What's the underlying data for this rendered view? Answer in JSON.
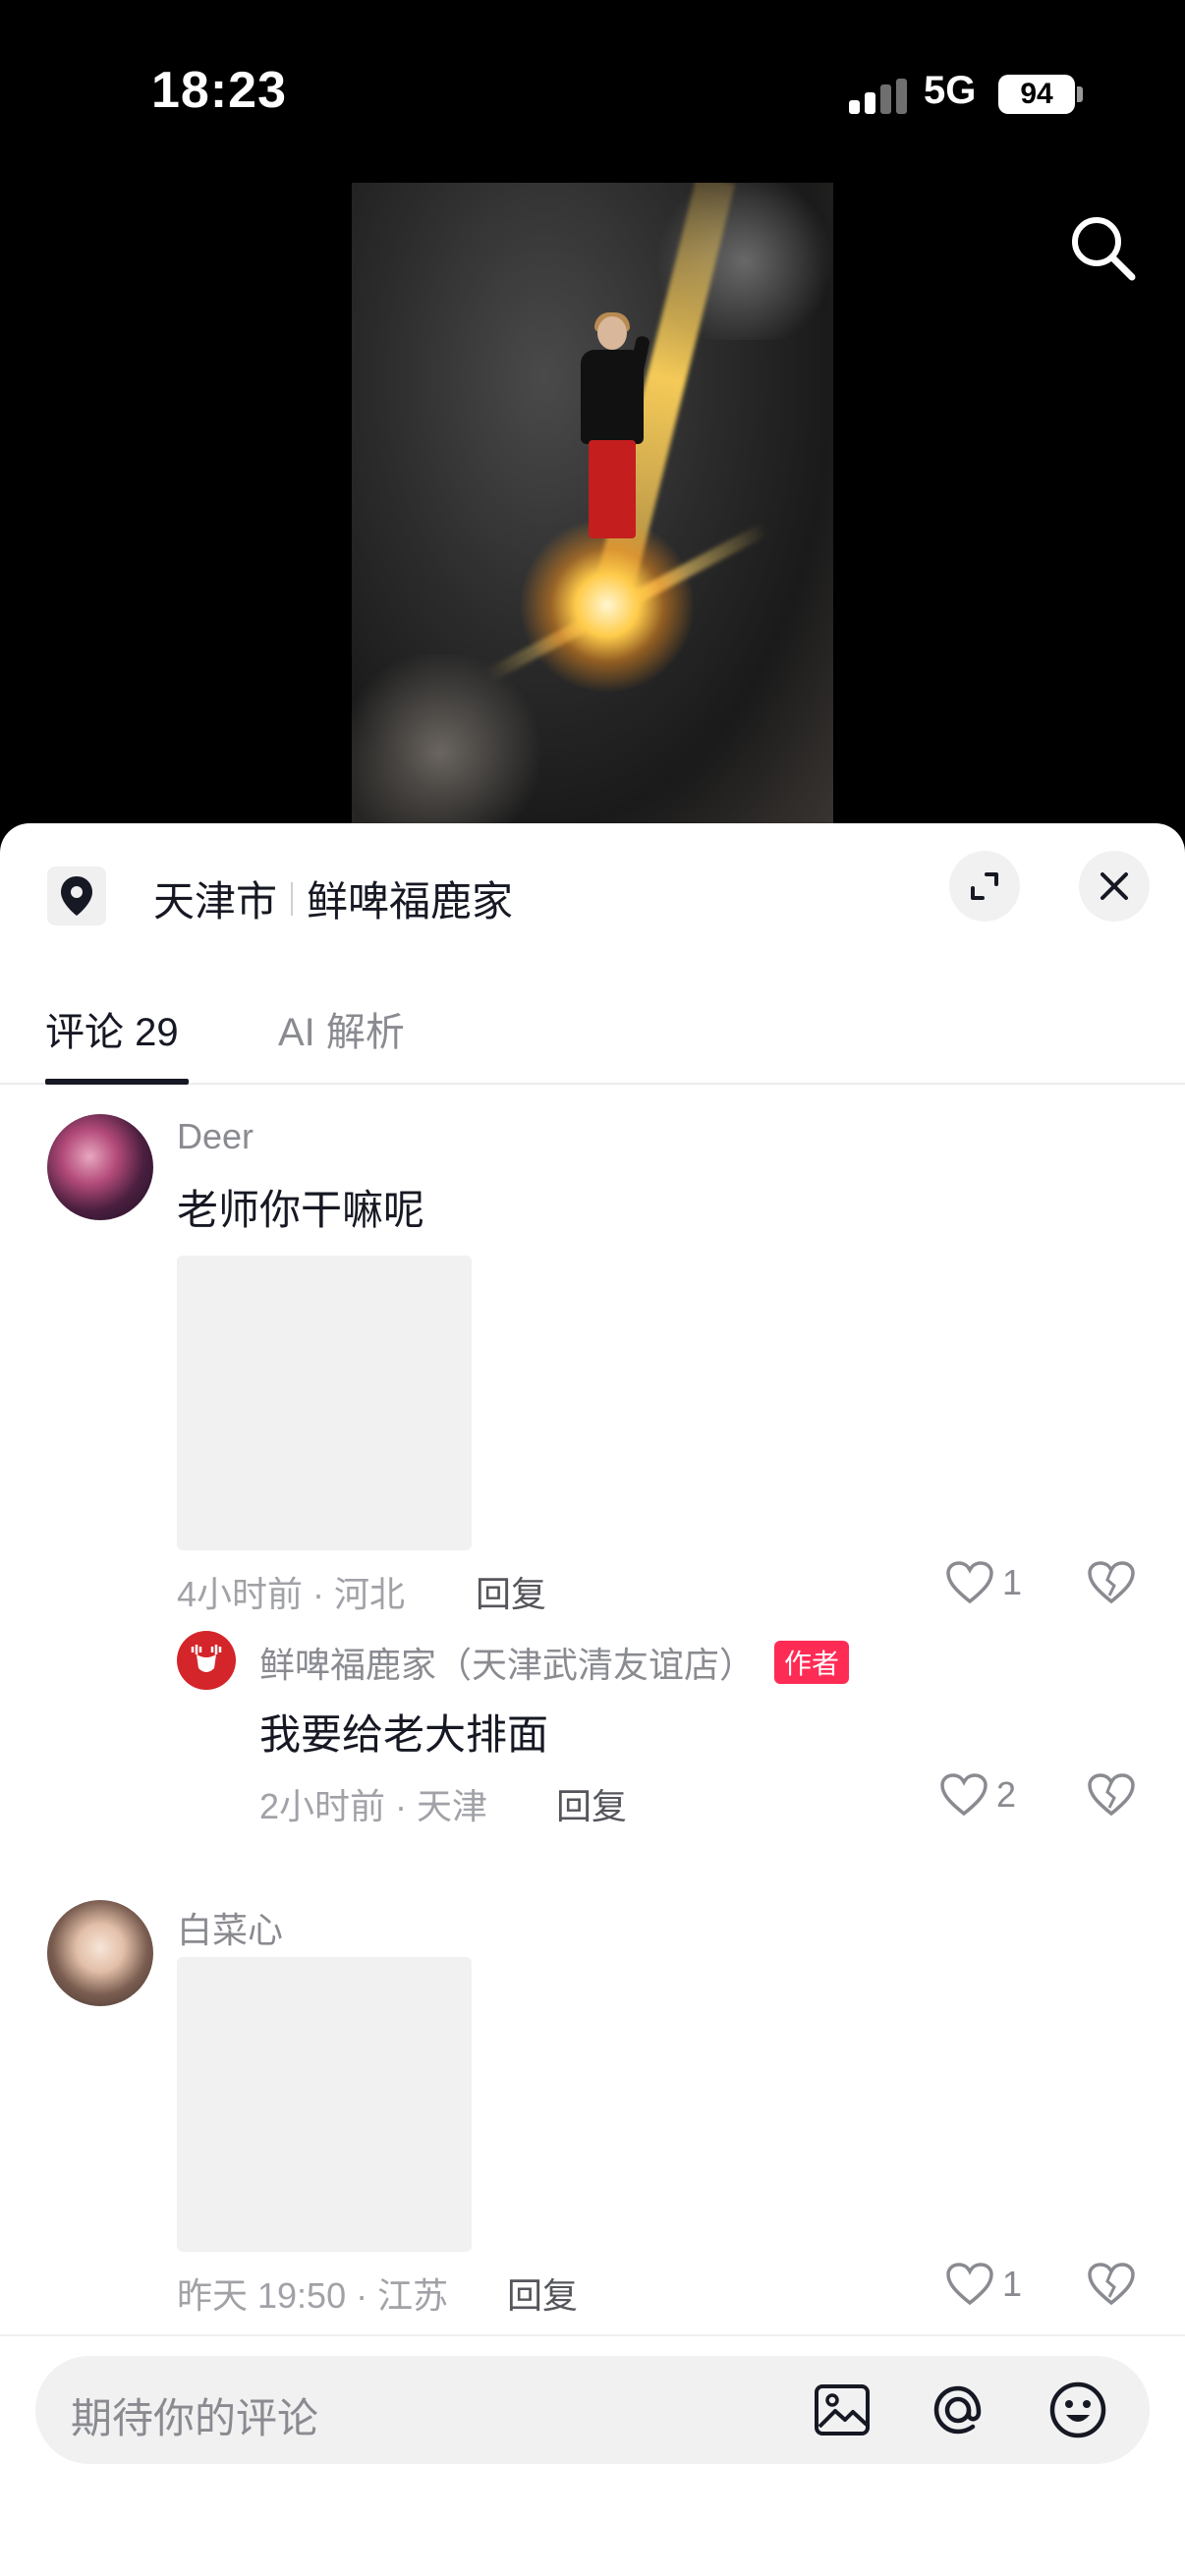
{
  "status_bar": {
    "time": "18:23",
    "network": "5G",
    "battery": "94"
  },
  "header": {
    "city": "天津市",
    "place": "鲜啤福鹿家"
  },
  "tabs": [
    {
      "label": "评论 29"
    },
    {
      "label": "AI 解析"
    }
  ],
  "comments": [
    {
      "user": "Deer",
      "text": "老师你干嘛呢",
      "time_location": "4小时前 · 河北",
      "reply_label": "回复",
      "likes": "1",
      "replies": [
        {
          "user": "鲜啤福鹿家（天津武清友谊店）",
          "badge": "作者",
          "text": "我要给老大排面",
          "time_location": "2小时前 · 天津",
          "reply_label": "回复",
          "likes": "2"
        }
      ]
    },
    {
      "user": "白菜心",
      "time_location": "昨天 19:50 · 江苏",
      "reply_label": "回复",
      "likes": "1"
    }
  ],
  "input": {
    "placeholder": "期待你的评论"
  },
  "colors": {
    "accent": "#fe2c55",
    "text": "#161823",
    "muted": "#8a8b91"
  }
}
